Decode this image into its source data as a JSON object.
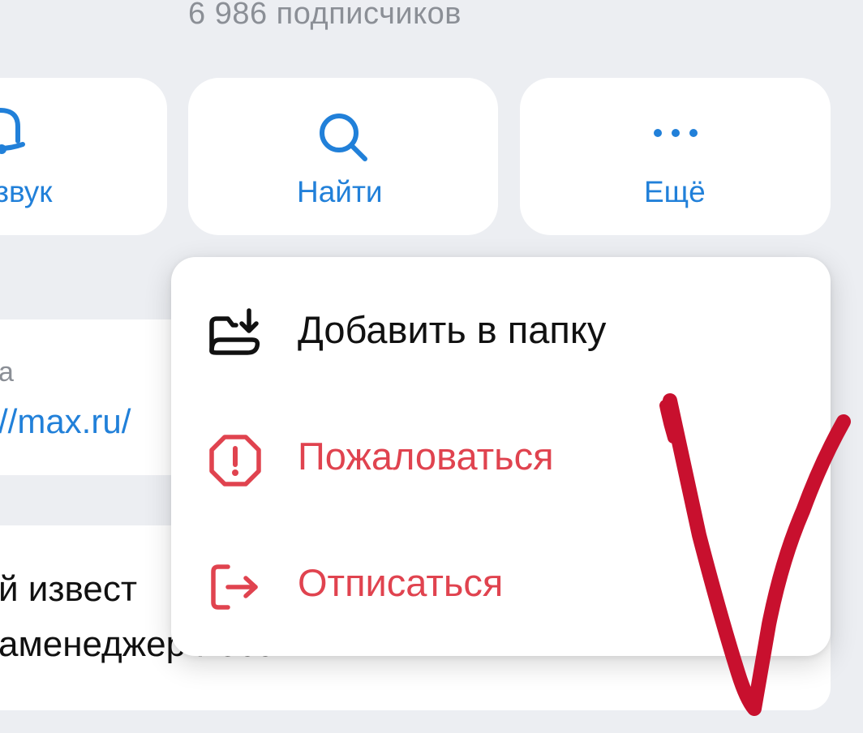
{
  "header": {
    "subscribers": "6 986 подписчиков"
  },
  "actions": {
    "sound_label": "звук",
    "find_label": "Найти",
    "more_label": "Ещё"
  },
  "info": {
    "link_caption": "а",
    "link_text": "//max.ru/",
    "desc_line_1": "й извест",
    "desc_line_2": "аменеджер России"
  },
  "menu": {
    "add_to_folder": "Добавить в папку",
    "report": "Пожаловаться",
    "unsubscribe": "Отписаться"
  },
  "colors": {
    "accent": "#2180d9",
    "danger": "#e0434f",
    "background": "#eceef2",
    "scribble": "#c8102e"
  },
  "icons": {
    "sound": "bell-icon",
    "find": "search-icon",
    "more": "more-dots-icon",
    "add_to_folder": "folder-download-icon",
    "report": "warning-octagon-icon",
    "unsubscribe": "exit-icon"
  }
}
